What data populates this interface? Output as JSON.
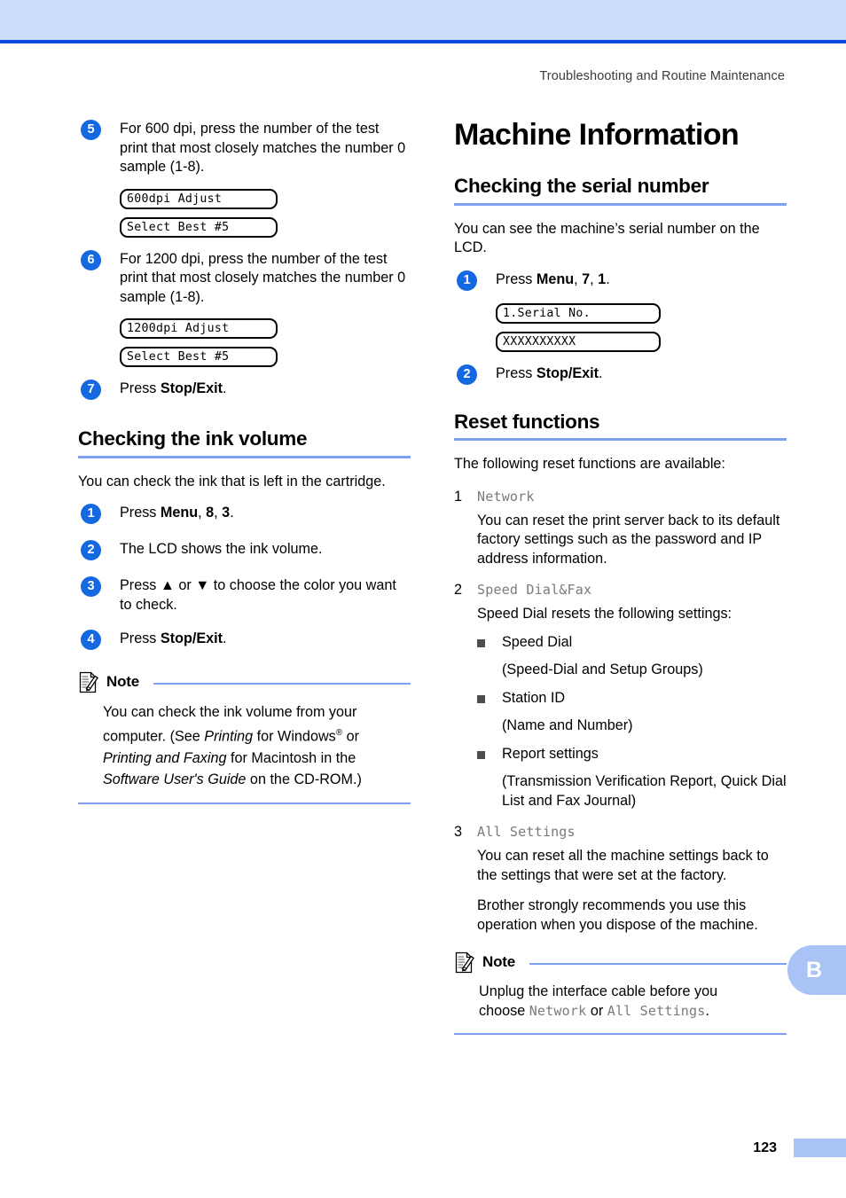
{
  "header": {
    "running_title": "Troubleshooting and Routine Maintenance"
  },
  "footer": {
    "page_number": "123",
    "chapter_tab": "B"
  },
  "left_column": {
    "steps_continued": [
      {
        "number": "5",
        "text": "For 600 dpi, press the number of the test print that most closely matches the number 0 sample (1-8).",
        "lcd": [
          "600dpi Adjust",
          "Select Best #5"
        ]
      },
      {
        "number": "6",
        "text": "For 1200 dpi, press the number of the test print that most closely matches the number 0 sample (1-8).",
        "lcd": [
          "1200dpi Adjust",
          "Select Best #5"
        ]
      },
      {
        "number": "7",
        "text_prefix": "Press ",
        "text_bold": "Stop/Exit",
        "text_suffix": "."
      }
    ],
    "section": {
      "heading": "Checking the ink volume",
      "intro": "You can check the ink that is left in the cartridge.",
      "steps": [
        {
          "number": "1",
          "prefix": "Press ",
          "bold1": "Menu",
          "mid1": ", ",
          "bold2": "8",
          "mid2": ", ",
          "bold3": "3",
          "suffix": "."
        },
        {
          "number": "2",
          "plain": "The LCD shows the ink volume."
        },
        {
          "number": "3",
          "plain": "Press ▲ or ▼ to choose the color you want to check."
        },
        {
          "number": "4",
          "prefix": "Press ",
          "bold1": "Stop/Exit",
          "suffix": "."
        }
      ],
      "note": {
        "label": "Note",
        "line1": "You can check the ink volume from your",
        "line2a": "computer. (See ",
        "line2_italic": "Printing",
        "line2b": " for Windows",
        "line2_reg": "®",
        "line2c": " or",
        "line3_italic": "Printing and Faxing",
        "line3b": " for Macintosh in the",
        "line4_italic": "Software User's Guide",
        "line4b": " on the CD-ROM.)"
      }
    }
  },
  "right_column": {
    "h1": "Machine Information",
    "serial_section": {
      "heading": "Checking the serial number",
      "intro": "You can see the machine’s serial number on the LCD.",
      "steps": [
        {
          "number": "1",
          "prefix": "Press ",
          "bold1": "Menu",
          "mid1": ", ",
          "bold2": "7",
          "mid2": ", ",
          "bold3": "1",
          "suffix": "."
        },
        {
          "number": "2",
          "prefix": "Press ",
          "bold1": "Stop/Exit",
          "suffix": "."
        }
      ],
      "lcd": [
        "1.Serial No.",
        "XXXXXXXXXX"
      ]
    },
    "reset_section": {
      "heading": "Reset functions",
      "intro": "The following reset functions are available:",
      "items": [
        {
          "number": "1",
          "code": "Network",
          "body": "You can reset the print server back to its default factory settings such as the password and IP address information."
        },
        {
          "number": "2",
          "code": "Speed Dial&Fax",
          "body": "Speed Dial resets the following settings:",
          "bullets": [
            {
              "label": "Speed Dial",
              "sub": "(Speed-Dial and Setup Groups)"
            },
            {
              "label": "Station ID",
              "sub": "(Name and Number)"
            },
            {
              "label": "Report settings",
              "sub": "(Transmission Verification Report, Quick Dial List and Fax Journal)"
            }
          ]
        },
        {
          "number": "3",
          "code": "All Settings",
          "body": "You can reset all the machine settings back to the settings that were set at the factory.",
          "body2": "Brother strongly recommends you use this operation when you dispose of the machine."
        }
      ],
      "note": {
        "label": "Note",
        "line1": "Unplug the interface cable before you",
        "line2_prefix": "choose ",
        "line2_code1": "Network",
        "line2_mid": " or ",
        "line2_code2": "All Settings",
        "line2_suffix": "."
      }
    }
  },
  "colors": {
    "band": "#ccdcfb",
    "rule": "#0b4ce0",
    "heading_rule": "#7f9ff2",
    "step_circle": "#1569e0",
    "tab": "#a9c3f7",
    "bullet": "#4d4d4d"
  }
}
